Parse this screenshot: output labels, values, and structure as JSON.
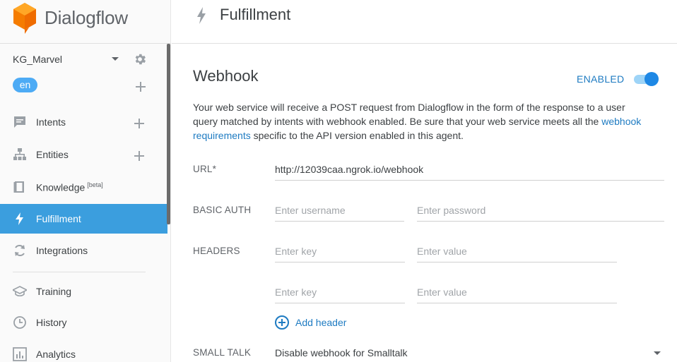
{
  "app": {
    "name": "Dialogflow"
  },
  "agent": {
    "name": "KG_Marvel",
    "language": "en"
  },
  "sidebar": {
    "items": [
      {
        "label": "Intents",
        "icon": "chat-bubble-icon",
        "has_add": true
      },
      {
        "label": "Entities",
        "icon": "hierarchy-icon",
        "has_add": true
      },
      {
        "label": "Knowledge",
        "badge": "[beta]",
        "icon": "book-icon"
      },
      {
        "label": "Fulfillment",
        "icon": "lightning-icon",
        "active": true
      },
      {
        "label": "Integrations",
        "icon": "sync-icon"
      },
      {
        "label": "Training",
        "icon": "graduation-cap-icon"
      },
      {
        "label": "History",
        "icon": "clock-icon"
      },
      {
        "label": "Analytics",
        "icon": "bar-chart-icon"
      }
    ]
  },
  "header": {
    "title": "Fulfillment"
  },
  "webhook": {
    "title": "Webhook",
    "status_label": "ENABLED",
    "enabled": true,
    "description_part1": "Your web service will receive a POST request from Dialogflow in the form of the response to a user query matched by intents with webhook enabled. Be sure that your web service meets all the ",
    "description_link": "webhook requirements",
    "description_part2": " specific to the API version enabled in this agent.",
    "url_label": "URL*",
    "url_value": "http://12039caa.ngrok.io/webhook",
    "basic_auth_label": "BASIC AUTH",
    "username_placeholder": "Enter username",
    "password_placeholder": "Enter password",
    "headers_label": "HEADERS",
    "key_placeholder": "Enter key",
    "value_placeholder": "Enter value",
    "add_header_label": "Add header",
    "small_talk_label": "SMALL TALK",
    "small_talk_value": "Disable webhook for Smalltalk"
  },
  "colors": {
    "accent": "#3b9ede",
    "link": "#1e7bc2",
    "toggle": "#1e88e5"
  }
}
